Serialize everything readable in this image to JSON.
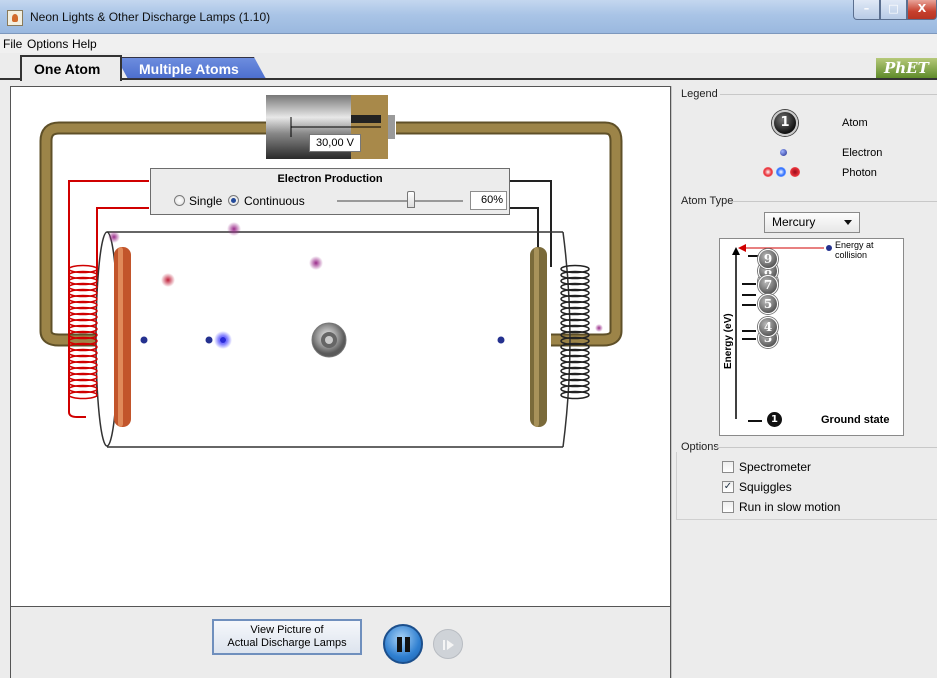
{
  "window": {
    "title": "Neon Lights & Other Discharge Lamps (1.10)",
    "min": "–",
    "max": "□",
    "close": "X"
  },
  "menu": [
    "File",
    "Options",
    "Help"
  ],
  "tabs": {
    "active": "One Atom",
    "inactive": "Multiple Atoms"
  },
  "logo": "PhET",
  "battery": {
    "voltage": "30,00 V"
  },
  "electron_production": {
    "title": "Electron Production",
    "single": "Single",
    "continuous": "Continuous",
    "mode": "Continuous",
    "rate": "60%",
    "rate_value": 0.6
  },
  "legend": {
    "title": "Legend",
    "atom": "Atom",
    "atom_symbol": "1",
    "electron": "Electron",
    "photon": "Photon"
  },
  "atom_type": {
    "title": "Atom Type",
    "selected": "Mercury"
  },
  "energy_diagram": {
    "axis_label": "Energy (eV)",
    "collision_label": "Energy at collision",
    "ground_state_label": "Ground state",
    "levels": [
      "9",
      "8",
      "7",
      "6",
      "5",
      "4",
      "3",
      "1"
    ]
  },
  "options": {
    "title": "Options",
    "items": [
      {
        "label": "Spectrometer",
        "checked": false
      },
      {
        "label": "Squiggles",
        "checked": true
      },
      {
        "label": "Run in slow motion",
        "checked": false
      }
    ]
  },
  "controls": {
    "view_picture_line1": "View Picture of",
    "view_picture_line2": "Actual Discharge Lamps"
  },
  "colors": {
    "tab_blue": "#4d6fce",
    "wire_brown": "#8b7640",
    "heater_red": "#d00000",
    "electron": "#1e2a8c"
  }
}
